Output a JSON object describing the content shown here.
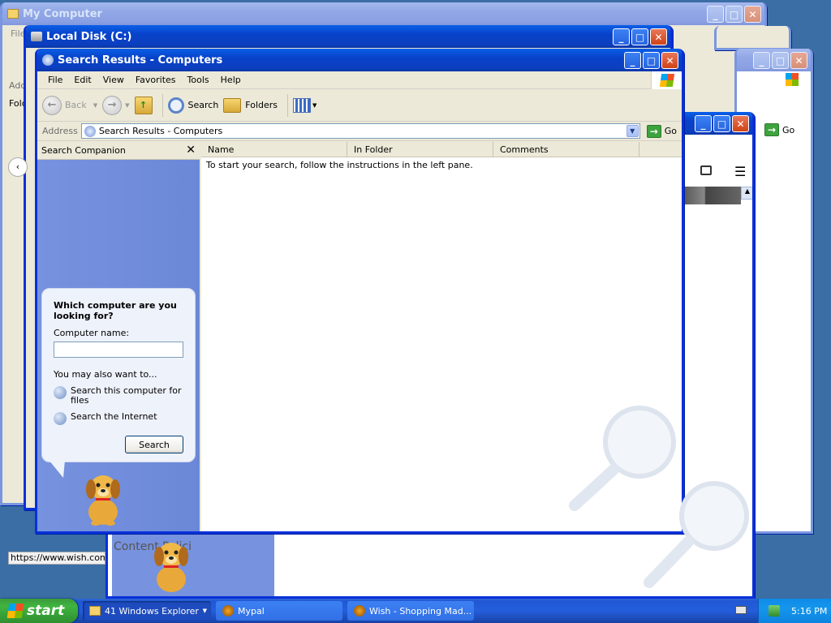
{
  "background_windows": {
    "my_computer": {
      "title": "My Computer",
      "menu_file": "File",
      "address_label": "Add",
      "folders_label": "Fold"
    },
    "local_disk": {
      "title": "Local Disk (C:)"
    },
    "right_window": {
      "go_label": "Go"
    },
    "browser": {
      "status_url": "https://www.wish.com/f",
      "partial_text": "Content Polici"
    }
  },
  "window": {
    "title": "Search Results - Computers",
    "menu": [
      "File",
      "Edit",
      "View",
      "Favorites",
      "Tools",
      "Help"
    ],
    "toolbar": {
      "back": "Back",
      "search": "Search",
      "folders": "Folders"
    },
    "address": {
      "label": "Address",
      "value": "Search Results - Computers",
      "go": "Go"
    },
    "companion": {
      "title": "Search Companion",
      "question": "Which computer are you looking for?",
      "computer_name_label": "Computer name:",
      "computer_name_value": "",
      "also_label": "You may also want to...",
      "link_files": "Search this computer for files",
      "link_internet": "Search the Internet",
      "search_button": "Search"
    },
    "columns": [
      "Name",
      "In Folder",
      "Comments"
    ],
    "instruction": "To start your search, follow the instructions in the left pane."
  },
  "taskbar": {
    "start": "start",
    "tasks": [
      {
        "label": "41 Windows Explorer",
        "active": true
      },
      {
        "label": "Mypal",
        "active": false
      },
      {
        "label": "Wish - Shopping Mad...",
        "active": false
      }
    ],
    "clock": "5:16 PM"
  },
  "colors": {
    "xp_blue": "#0831d9",
    "companion_blue": "#7792de",
    "start_green": "#3fb53f"
  }
}
